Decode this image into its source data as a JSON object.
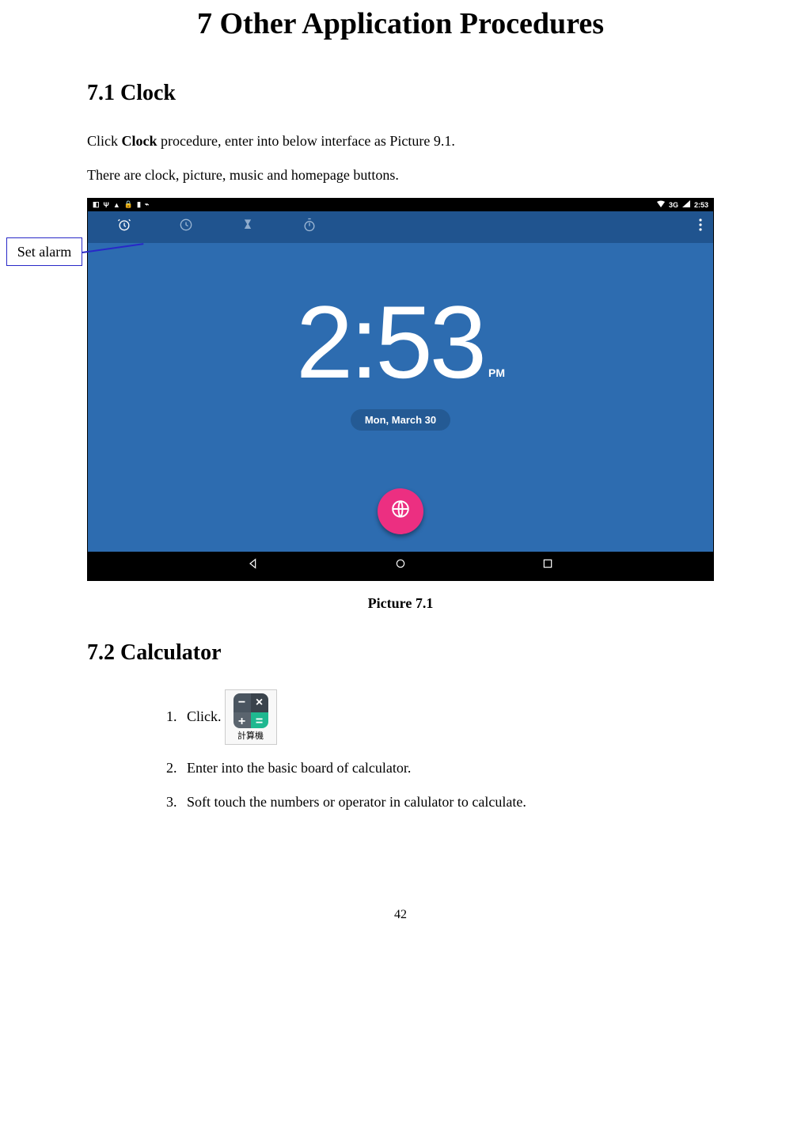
{
  "chapter_title": "7 Other Application Procedures",
  "section_71": {
    "title": "7.1 Clock",
    "p1_pre": "Click ",
    "p1_bold": "Clock",
    "p1_post": " procedure, enter into below interface as Picture 9.1.",
    "p2": "There are clock, picture, music and homepage buttons."
  },
  "callout_label": "Set alarm",
  "screenshot": {
    "status_time": "2:53",
    "status_network": "3G",
    "big_time": "2:53",
    "ampm": "PM",
    "date": "Mon, March 30"
  },
  "figure_caption": "Picture 7.1",
  "section_72": {
    "title": "7.2 Calculator",
    "steps": [
      {
        "num": "1.",
        "text": "Click."
      },
      {
        "num": "2.",
        "text": "Enter into the basic board of calculator."
      },
      {
        "num": "3.",
        "text": "Soft touch the numbers or operator in calulator to calculate."
      }
    ],
    "calc_icon_label": "計算機"
  },
  "page_number": "42"
}
